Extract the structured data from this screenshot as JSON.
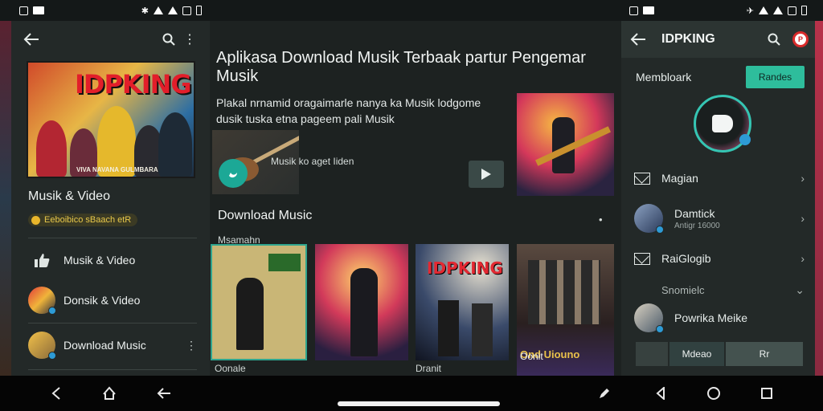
{
  "status_left": {
    "time_icons": [
      "sim-icon",
      "photo-icon"
    ]
  },
  "status_right": {
    "time_icons": [
      "sim-icon",
      "photo-icon"
    ]
  },
  "left_panel": {
    "poster_title": "IDPKING",
    "poster_caption": "VIVA NAVANA GULMBARA",
    "section_title": "Musik & Video",
    "badge": "Eeboibico sBaach etR",
    "items": [
      {
        "label": "Musik & Video"
      },
      {
        "label": "Donsik & Video"
      },
      {
        "label": "Download Music",
        "more": "⋮"
      }
    ]
  },
  "middle": {
    "title": "Aplikasa Download Musik Terbaak partur Pengemar Musik",
    "description": "Plakal nrnamid oragaimarle nanya ka Musik lodgome dusik tuska etna pageem pali Musik",
    "video_caption": "Musik ko aget Iiden",
    "section_title": "Download Music",
    "more": "•",
    "subheading": "Msamahn",
    "tiles": [
      {
        "caption": "Oonale"
      },
      {
        "caption": ""
      },
      {
        "title": "IDPKING",
        "caption": "Dranit"
      },
      {
        "caption": "Oonit",
        "sub": "Ond Uiouno"
      }
    ]
  },
  "right_panel": {
    "title": "IDPKING",
    "member_label": "Membloark",
    "action_button": "Randes",
    "rows": [
      {
        "label": "Magian"
      },
      {
        "label": "Damtick",
        "sub": "Antigr 16000"
      },
      {
        "label": "RaiGlogib"
      }
    ],
    "section": "Snomielc",
    "contact": "Powrika Meike",
    "tabs": [
      {
        "label": ""
      },
      {
        "label": "Mdeao"
      },
      {
        "label": "Rr"
      }
    ]
  },
  "colors": {
    "accent": "#2ebd9c",
    "teal_fab": "#1ca896",
    "panel_bg": "#232928",
    "badge_text": "#e8c84a"
  }
}
